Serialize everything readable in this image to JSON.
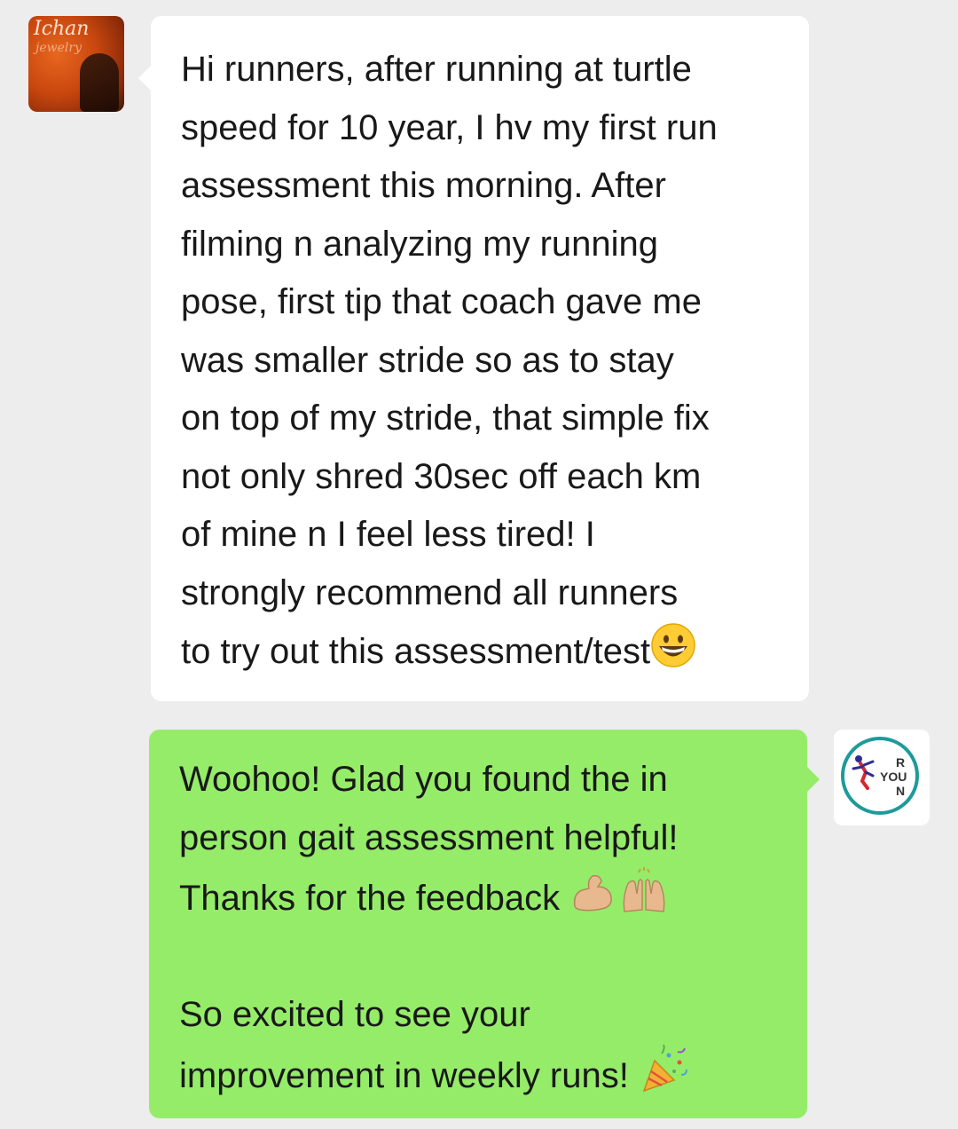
{
  "conversation": {
    "incoming": {
      "avatar": {
        "logo_text": "Ichan",
        "logo_sub": "jewelry",
        "icon": "profile-photo-icon"
      },
      "text": "Hi runners, after running at turtle\nspeed for 10 year, I hv my first run\nassessment this morning. After\nfilming n analyzing my running\npose, first tip that coach gave me\nwas smaller stride so as to stay\non top of my stride, that simple fix\nnot only shred 30sec off each km\nof mine n I feel less tired! I\nstrongly recommend all runners\nto try out this assessment/test",
      "trailing_emoji": "grinning-face-icon",
      "bubble_color": "#ffffff"
    },
    "outgoing": {
      "avatar": {
        "brand_letters": [
          "R",
          "YOU",
          "N"
        ],
        "icon": "runner-logo-icon",
        "ring_color": "#1f9a9a"
      },
      "line1_text": "Woohoo! Glad you found the in\nperson gait assessment helpful!\nThanks for the feedback ",
      "line1_emojis": [
        "flexed-biceps-icon",
        "raising-hands-icon"
      ],
      "line2_text": "\n\nSo excited to see your\nimprovement in weekly runs! ",
      "line2_emoji": "party-popper-icon",
      "bubble_color": "#95ec69"
    },
    "background_color": "#ededed"
  }
}
